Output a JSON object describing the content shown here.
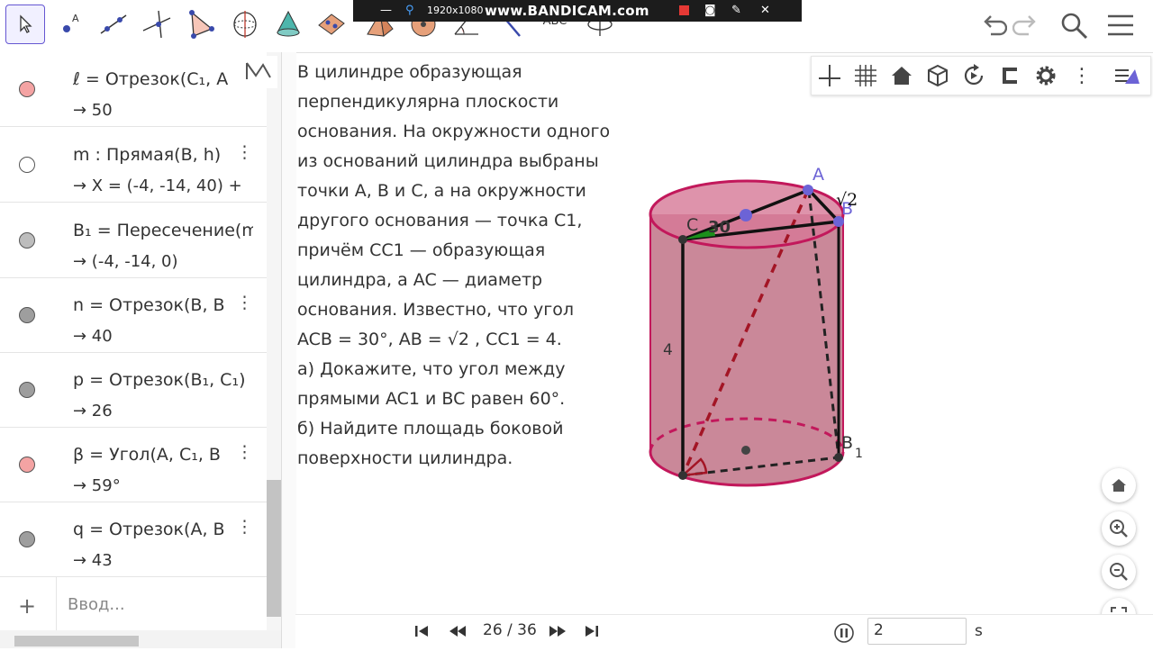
{
  "app": {
    "name": "GeoGebra"
  },
  "toolbar": {
    "tools": [
      "move-tool",
      "point-tool",
      "segment-tool",
      "perpendicular-line-tool",
      "polygon-tool",
      "circle-tool",
      "cone-tool",
      "plane-tool",
      "pyramid-tool",
      "sphere-tool",
      "angle-tool",
      "reflect-tool",
      "text-tool",
      "rotate-view-tool"
    ],
    "text_tool_label": "ABC"
  },
  "recorder": {
    "resolution": "1920x1080",
    "brand": "www.BANDICAM.com"
  },
  "algebra": {
    "rows": [
      {
        "color": "#f4a3a3",
        "definition": "ℓ = Отрезок(C₁, A",
        "value": "→ 50"
      },
      {
        "color": "#ffffff",
        "definition": "m : Прямая(B, h)",
        "value": "→ X = (-4, -14, 40) +"
      },
      {
        "color": "#bdbdbd",
        "definition": "B₁ = Пересечение(m",
        "value": "→ (-4, -14, 0)"
      },
      {
        "color": "#9e9e9e",
        "definition": "n = Отрезок(B, B",
        "value": "→ 40"
      },
      {
        "color": "#9e9e9e",
        "definition": "p = Отрезок(B₁, C₁)",
        "value": "→ 26"
      },
      {
        "color": "#f4a3a3",
        "definition": "β = Угол(A, C₁, B",
        "value": "→ 59°"
      },
      {
        "color": "#9e9e9e",
        "definition": "q = Отрезок(A, B",
        "value": "→ 43"
      }
    ],
    "input_placeholder": "Ввод..."
  },
  "problem": {
    "lines": [
      " В цилиндре образующая",
      " перпендикулярна плоскости",
      " основания. На окружности одного",
      "из оснований цилиндра выбраны",
      " точки A, B и C, а на окружности",
      " другого основания — точка C1,",
      " причём CC1 — образующая",
      " цилиндра, а AC — диаметр",
      " основания. Известно, что угол",
      "ACB = 30°, AB = √2 , CC1 = 4.",
      "а) Докажите, что угол между",
      " прямыми AC1 и BC равен 60°.",
      "б) Найдите площадь боковой",
      " поверхности цилиндра."
    ]
  },
  "figure": {
    "labels": {
      "A": "A",
      "B": "B",
      "C": "C",
      "B1": "B",
      "B1_sub": "1",
      "height": "4",
      "angle": "30",
      "ab_length": "√2"
    },
    "fill_color": "#b55a72",
    "edge_color": "#c2185b"
  },
  "graphics_toolbar": {
    "icons": [
      "axes-icon",
      "grid-icon",
      "home-icon",
      "cube-view-icon",
      "rotate-icon",
      "clipping-icon",
      "settings-icon",
      "more-icon",
      "style-bar-icon"
    ]
  },
  "slideshow": {
    "page": "26 / 36",
    "speed_value": "2",
    "speed_unit": "s"
  }
}
